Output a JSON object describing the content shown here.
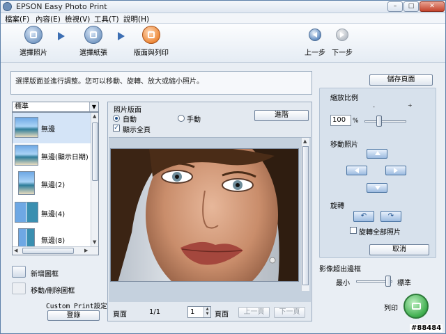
{
  "window": {
    "title": "EPSON Easy Photo Print"
  },
  "window_buttons": {
    "minimize": "–",
    "maximize": "□",
    "close": "✕"
  },
  "menu": [
    "檔案(F)",
    "內容(E)",
    "檢視(V)",
    "工具(T)",
    "說明(H)"
  ],
  "steps": [
    {
      "label": "選擇照片",
      "icon": "photo-select-icon",
      "active": false
    },
    {
      "label": "選擇紙張",
      "icon": "paper-select-icon",
      "active": false
    },
    {
      "label": "版面與列印",
      "icon": "layout-print-icon",
      "active": true
    }
  ],
  "nav": {
    "back": "上一步",
    "next": "下一步"
  },
  "instruction": "選擇版面並進行調整。您可以移動、旋轉、放大或縮小照片。",
  "save_page": "儲存頁面",
  "left": {
    "category": "標準",
    "layouts": [
      {
        "label": "無邊",
        "selected": true
      },
      {
        "label": "無邊(顯示日期)",
        "selected": false
      },
      {
        "label": "無邊(2)",
        "selected": false
      },
      {
        "label": "無邊(4)",
        "selected": false
      },
      {
        "label": "無邊(8)",
        "selected": false
      }
    ],
    "add_frame": "新增圖框",
    "move_delete_frame": "移動/刪除圖框",
    "custom_print_label": "Custom Print設定",
    "register": "登錄"
  },
  "center": {
    "group_title": "照片版面",
    "auto": "自動",
    "manual": "手動",
    "show_full_page": "顯示全頁",
    "advanced": "進階",
    "page_label": "頁面",
    "page_count": "1/1",
    "page_input": "1",
    "page_suffix": "頁面",
    "prev_page": "上一頁",
    "next_page": "下一頁"
  },
  "right": {
    "zoom_title": "縮放比例",
    "zoom_value": "100",
    "zoom_unit": "%",
    "zoom_minus": "-",
    "zoom_plus": "+",
    "move_title": "移動照片",
    "rotate_title": "旋轉",
    "rotate_all": "旋轉全部照片",
    "cancel": "取消"
  },
  "expansion": {
    "title": "影像超出邊框",
    "min": "最小",
    "standard": "標準",
    "level": "standard"
  },
  "print": "列印",
  "watermark": "#88484",
  "colors": {
    "accent": "#3d6fb3",
    "active_step": "#ee8a3a",
    "print_button": "#3fae4e"
  }
}
